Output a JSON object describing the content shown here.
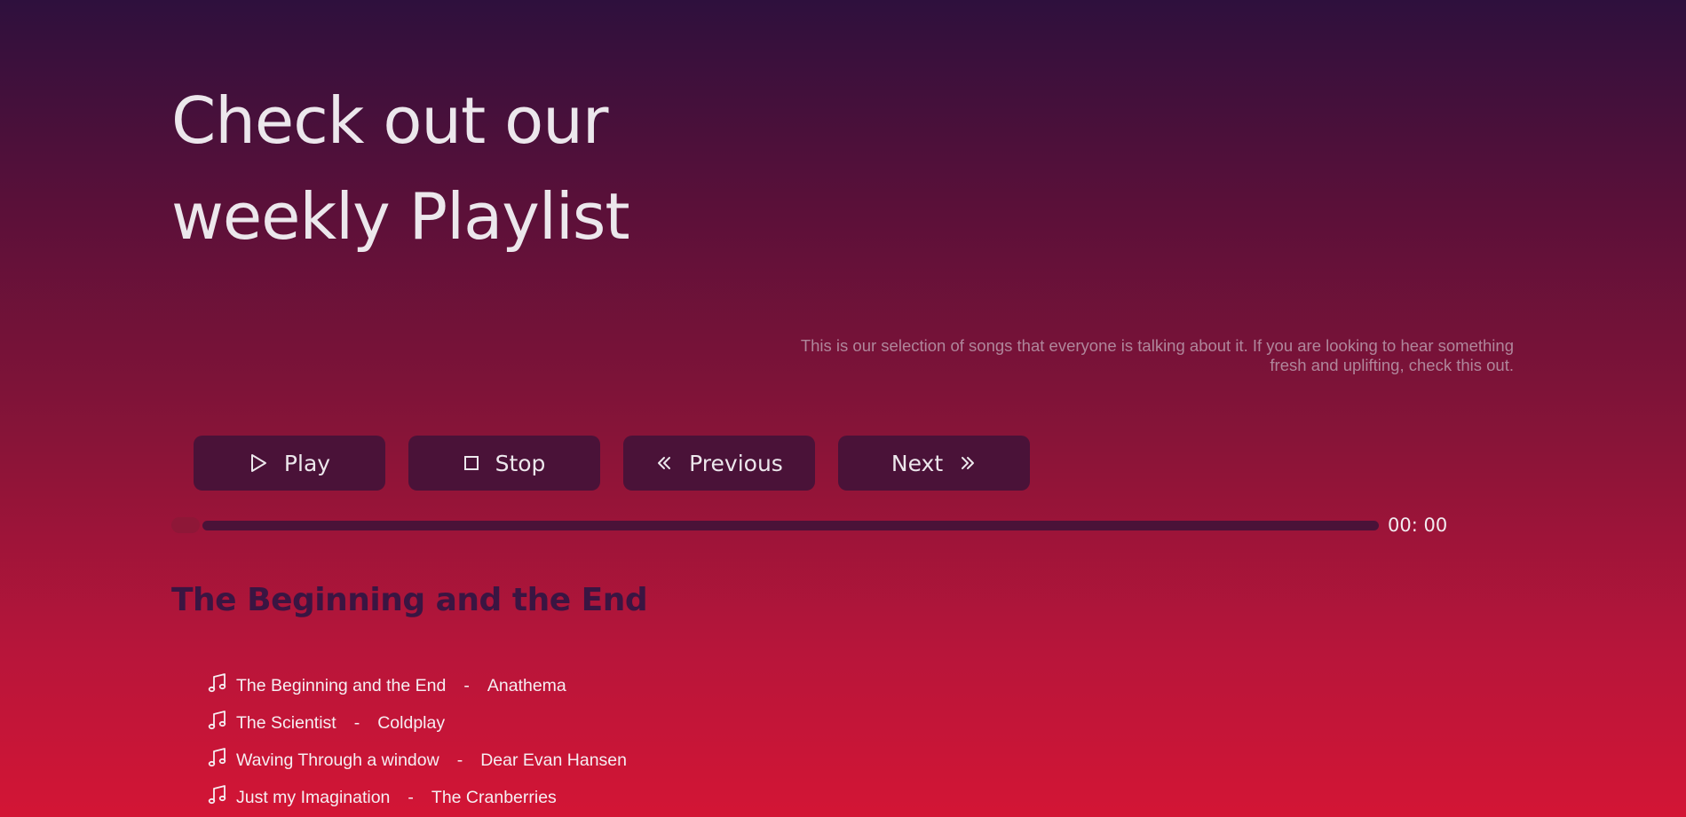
{
  "hero": {
    "title_line1": "Check out our",
    "title_line2": "weekly Playlist",
    "description": "This is our selection of songs that everyone is talking about it. If you are looking to hear something fresh and uplifting, check this out."
  },
  "controls": {
    "play_label": "Play",
    "stop_label": "Stop",
    "previous_label": "Previous",
    "next_label": "Next"
  },
  "player": {
    "time": "00: 00",
    "progress": 0,
    "now_playing": "The Beginning and the End"
  },
  "playlist": [
    {
      "title": "The Beginning and the End",
      "separator": "-",
      "artist": "Anathema"
    },
    {
      "title": "The Scientist",
      "separator": "-",
      "artist": "Coldplay"
    },
    {
      "title": "Waving Through a window",
      "separator": "-",
      "artist": "Dear Evan Hansen"
    },
    {
      "title": "Just my Imagination",
      "separator": "-",
      "artist": "The Cranberries"
    }
  ],
  "colors": {
    "button_bg": "#4a1238",
    "text_light": "#ece7ec",
    "heading_dark": "#3a1542"
  },
  "icons": {
    "play": "play-icon",
    "stop": "stop-icon",
    "previous": "chevrons-left-icon",
    "next": "chevrons-right-icon",
    "track": "music-note-icon"
  }
}
